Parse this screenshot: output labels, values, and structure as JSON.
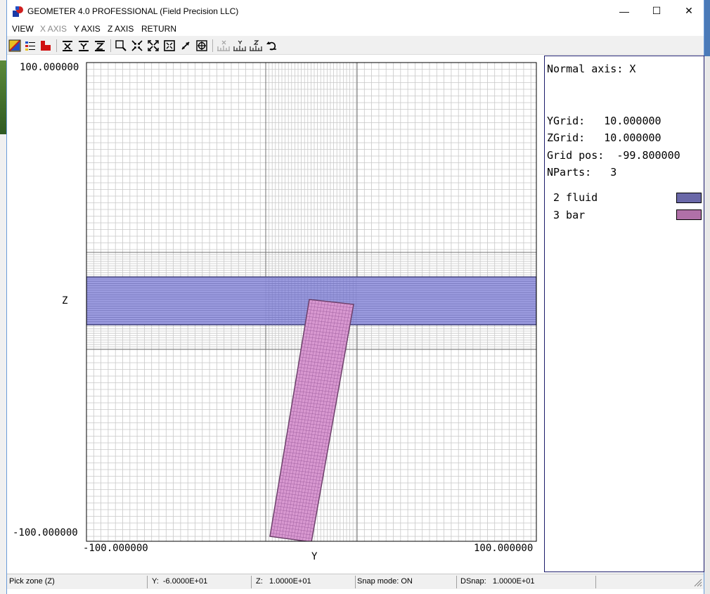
{
  "window": {
    "title": "GEOMETER 4.0 PROFESSIONAL (Field Precision LLC)",
    "minimize_glyph": "—",
    "maximize_glyph": "☐",
    "close_glyph": "✕"
  },
  "menu": {
    "items": [
      {
        "label": "VIEW",
        "enabled": true
      },
      {
        "label": "X AXIS",
        "enabled": false
      },
      {
        "label": "Y AXIS",
        "enabled": true
      },
      {
        "label": "Z AXIS",
        "enabled": true
      },
      {
        "label": "RETURN",
        "enabled": true
      }
    ]
  },
  "toolbar": {
    "icons": [
      "color-fill-icon",
      "legend-icon",
      "region-fill-icon",
      "x-filter-icon",
      "y-filter-icon",
      "z-filter-icon",
      "zoom-window-icon",
      "zoom-in-icon",
      "zoom-out-icon",
      "zoom-fit-icon",
      "pan-icon",
      "snap-target-icon",
      "x-axis-tool-icon",
      "y-axis-tool-icon",
      "z-axis-tool-icon",
      "undo-view-icon"
    ]
  },
  "plot": {
    "y_top_label": "100.000000",
    "y_bottom_label": "-100.000000",
    "x_left_label": "-100.000000",
    "x_right_label": "100.000000",
    "vertical_axis_label": "Z",
    "horizontal_axis_label": "Y"
  },
  "info": {
    "normal_axis": "Normal axis: X",
    "ygrid": "YGrid:   10.000000",
    "zgrid": "ZGrid:   10.000000",
    "grid_pos": "Grid pos:  -99.800000",
    "nparts": "NParts:   3",
    "legend": [
      {
        "label": "2 fluid",
        "color": "#6a68a8"
      },
      {
        "label": "3 bar",
        "color": "#b070a8"
      }
    ]
  },
  "status": {
    "mode": "Pick zone (Z)",
    "y": "Y:  -6.0000E+01",
    "z": "Z:   1.0000E+01",
    "snap": "Snap mode: ON",
    "dsnap": "DSnap:   1.0000E+01"
  },
  "colors": {
    "fluid_fill": "#9c9ce0",
    "fluid_edge": "#3e3e78",
    "bar_fill": "#d898d0",
    "bar_edge": "#6a3e68",
    "grid": "#c8c8c8"
  }
}
